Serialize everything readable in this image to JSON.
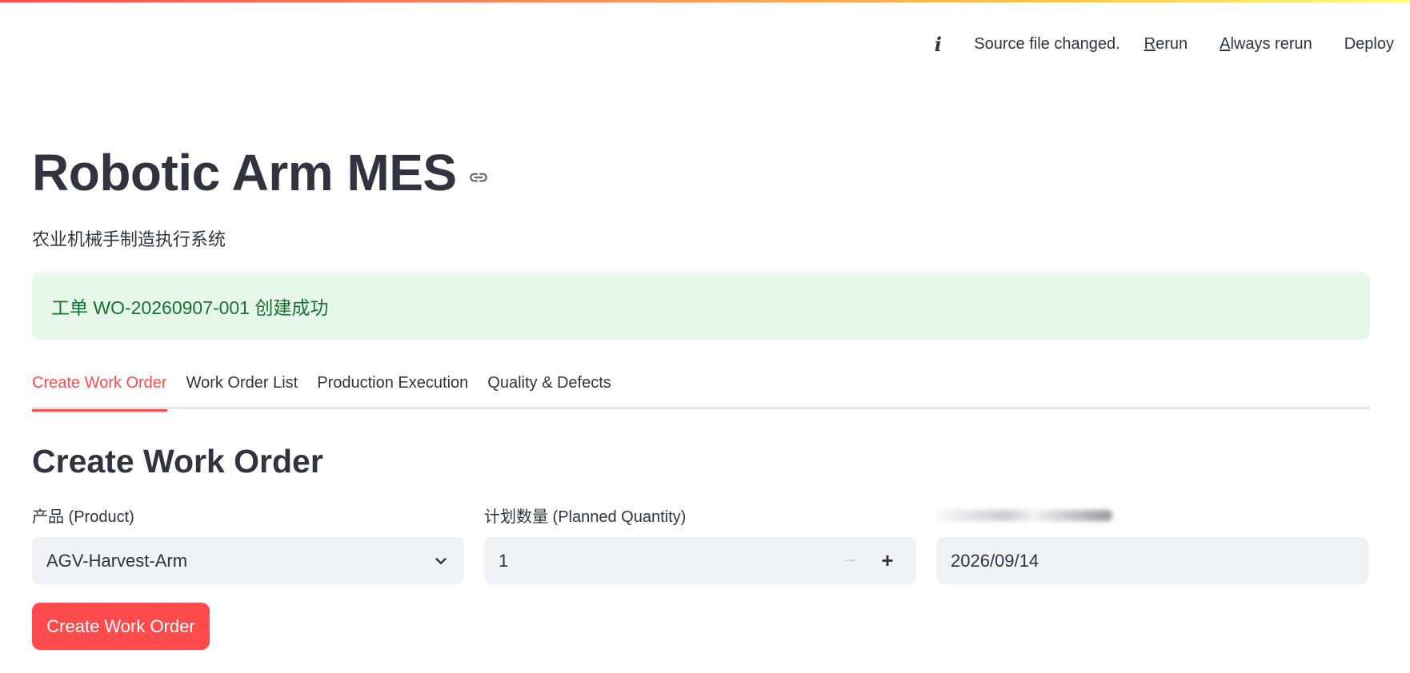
{
  "toolbar": {
    "status_text": "Source file changed.",
    "rerun_first": "R",
    "rerun_rest": "erun",
    "always_first": "A",
    "always_rest": "lways rerun",
    "deploy": "Deploy"
  },
  "header": {
    "title": "Robotic Arm MES",
    "subtitle": "农业机械手制造执行系统"
  },
  "alert": {
    "message": "工单 WO-20260907-001 创建成功"
  },
  "tabs": [
    {
      "label": "Create Work Order",
      "active": true
    },
    {
      "label": "Work Order List",
      "active": false
    },
    {
      "label": "Production Execution",
      "active": false
    },
    {
      "label": "Quality & Defects",
      "active": false
    }
  ],
  "form": {
    "section_title": "Create Work Order",
    "product": {
      "label": "产品 (Product)",
      "value": "AGV-Harvest-Arm"
    },
    "quantity": {
      "label": "计划数量 (Planned Quantity)",
      "value": "1",
      "minus": "−",
      "plus": "+"
    },
    "date": {
      "value": "2026/09/14"
    },
    "submit_label": "Create Work Order"
  },
  "colors": {
    "accent": "#ff4b4b",
    "success_bg": "#e6f7ea",
    "success_text": "#177233",
    "input_bg": "#f0f2f6"
  },
  "icons": [
    "info-icon",
    "link-icon",
    "chevron-down-icon"
  ]
}
